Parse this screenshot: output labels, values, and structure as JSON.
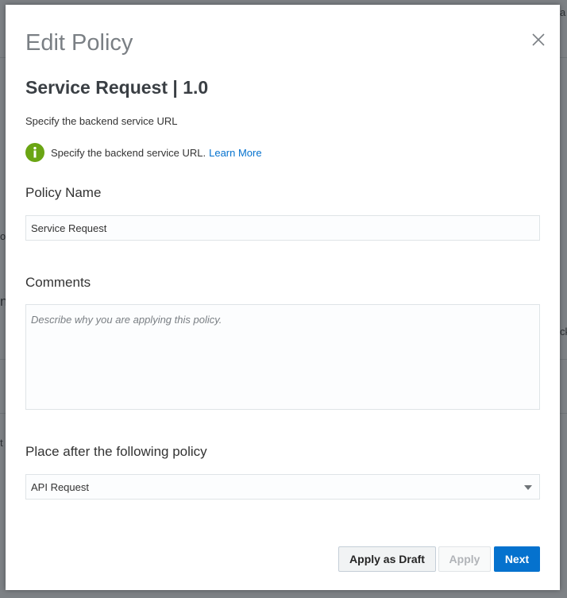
{
  "dialog": {
    "title": "Edit Policy",
    "subtitle": "Service Request | 1.0",
    "description": "Specify the backend service URL",
    "info": {
      "text": "Specify the backend service URL.",
      "link": "Learn More",
      "icon": "info-icon",
      "icon_color": "#6aa513"
    },
    "policy_name": {
      "label": "Policy Name",
      "value": "Service Request"
    },
    "comments": {
      "label": "Comments",
      "placeholder": "Describe why you are applying this policy.",
      "value": ""
    },
    "place_after": {
      "label": "Place after the following policy",
      "selected": "API Request"
    },
    "buttons": {
      "apply_as_draft": "Apply as Draft",
      "apply": "Apply",
      "next": "Next"
    },
    "accent_color": "#0572ce"
  },
  "background": {
    "fragments": [
      "a",
      "o",
      "n",
      "ck",
      "t"
    ]
  }
}
